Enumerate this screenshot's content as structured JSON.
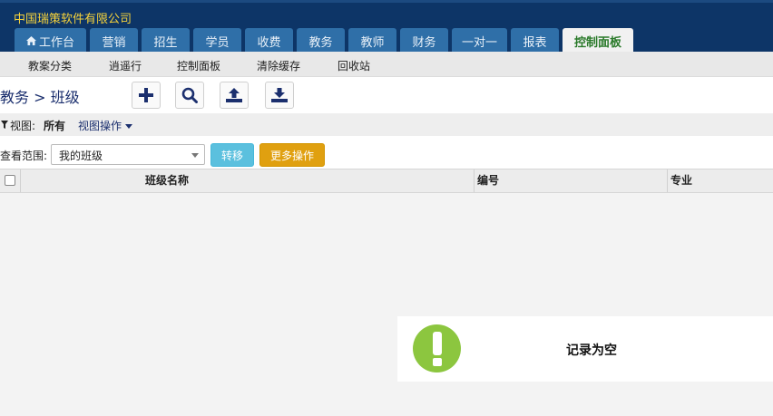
{
  "header": {
    "company": "中国瑞策软件有限公司",
    "tabs": [
      {
        "label": "工作台",
        "icon": "home-icon"
      },
      {
        "label": "营销"
      },
      {
        "label": "招生"
      },
      {
        "label": "学员"
      },
      {
        "label": "收费"
      },
      {
        "label": "教务"
      },
      {
        "label": "教师"
      },
      {
        "label": "财务"
      },
      {
        "label": "一对一"
      },
      {
        "label": "报表"
      },
      {
        "label": "控制面板",
        "active": true
      }
    ]
  },
  "subnav": {
    "items": [
      "教案分类",
      "逍遥行",
      "控制面板",
      "清除缓存",
      "回收站"
    ]
  },
  "toolbar": {
    "title": "教务 > 班级",
    "buttons": [
      "add-icon",
      "search-icon",
      "upload-icon",
      "download-icon"
    ]
  },
  "view": {
    "label": "视图:",
    "current": "所有",
    "ops": "视图操作"
  },
  "scope": {
    "label": "查看范围:",
    "selected": "我的班级",
    "move_button": "转移",
    "more_button": "更多操作"
  },
  "table": {
    "columns": [
      "班级名称",
      "编号",
      "专业"
    ]
  },
  "empty": {
    "message": "记录为空"
  },
  "colors": {
    "header_bg": "#0d3567",
    "tab_bg": "#2f6fa8",
    "active_tab_text": "#2a7a2a",
    "company_text": "#f5d23b",
    "info_button": "#5bc0de",
    "warning_button": "#e0a010",
    "empty_icon": "#8cc63f"
  }
}
